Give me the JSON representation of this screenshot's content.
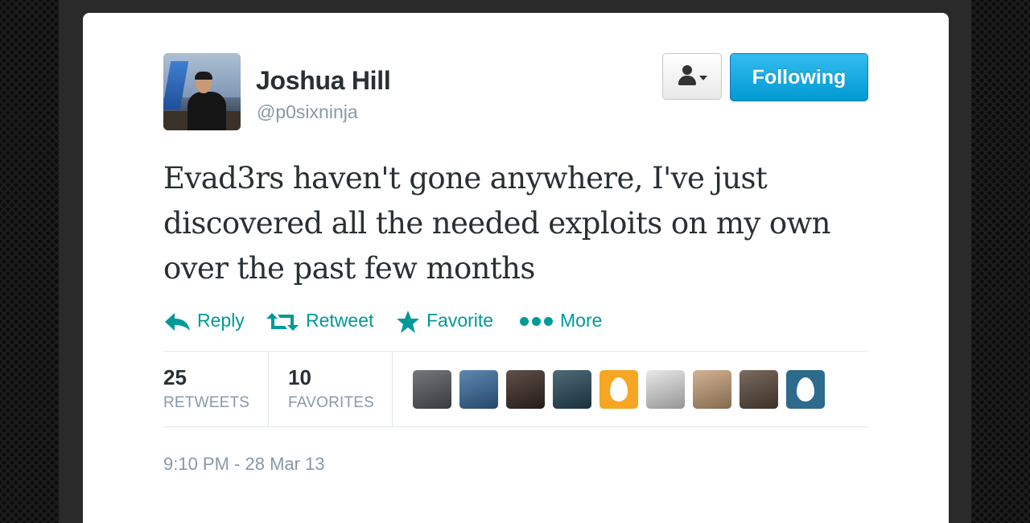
{
  "profile": {
    "name": "Joshua Hill",
    "handle": "@p0sixninja",
    "avatar_icon": "avatar"
  },
  "header": {
    "follow_button_label": "Following",
    "user_menu_icon": "user-dropdown-icon",
    "accent_color": "#019ad2"
  },
  "tweet": {
    "text": "Evad3rs haven't gone anywhere, I've just discovered all the needed exploits on my own over the past few months"
  },
  "actions": {
    "reply": "Reply",
    "retweet": "Retweet",
    "favorite": "Favorite",
    "more": "More",
    "color": "#009999"
  },
  "stats": {
    "retweets_count": "25",
    "retweets_label": "RETWEETS",
    "favorites_count": "10",
    "favorites_label": "FAVORITES"
  },
  "favoriters": [
    {
      "kind": "photo",
      "color": "#555a60"
    },
    {
      "kind": "photo",
      "color": "#3a6ea0"
    },
    {
      "kind": "photo",
      "color": "#3b2a22"
    },
    {
      "kind": "photo",
      "color": "#274a5a"
    },
    {
      "kind": "default-egg",
      "color": "#f6a623"
    },
    {
      "kind": "photo",
      "color": "#e4e4e4"
    },
    {
      "kind": "photo",
      "color": "#c9a27a"
    },
    {
      "kind": "photo",
      "color": "#5c4a3c"
    },
    {
      "kind": "default-egg",
      "color": "#2d6a8c"
    }
  ],
  "meta": {
    "timestamp": "9:10 PM - 28 Mar 13"
  }
}
